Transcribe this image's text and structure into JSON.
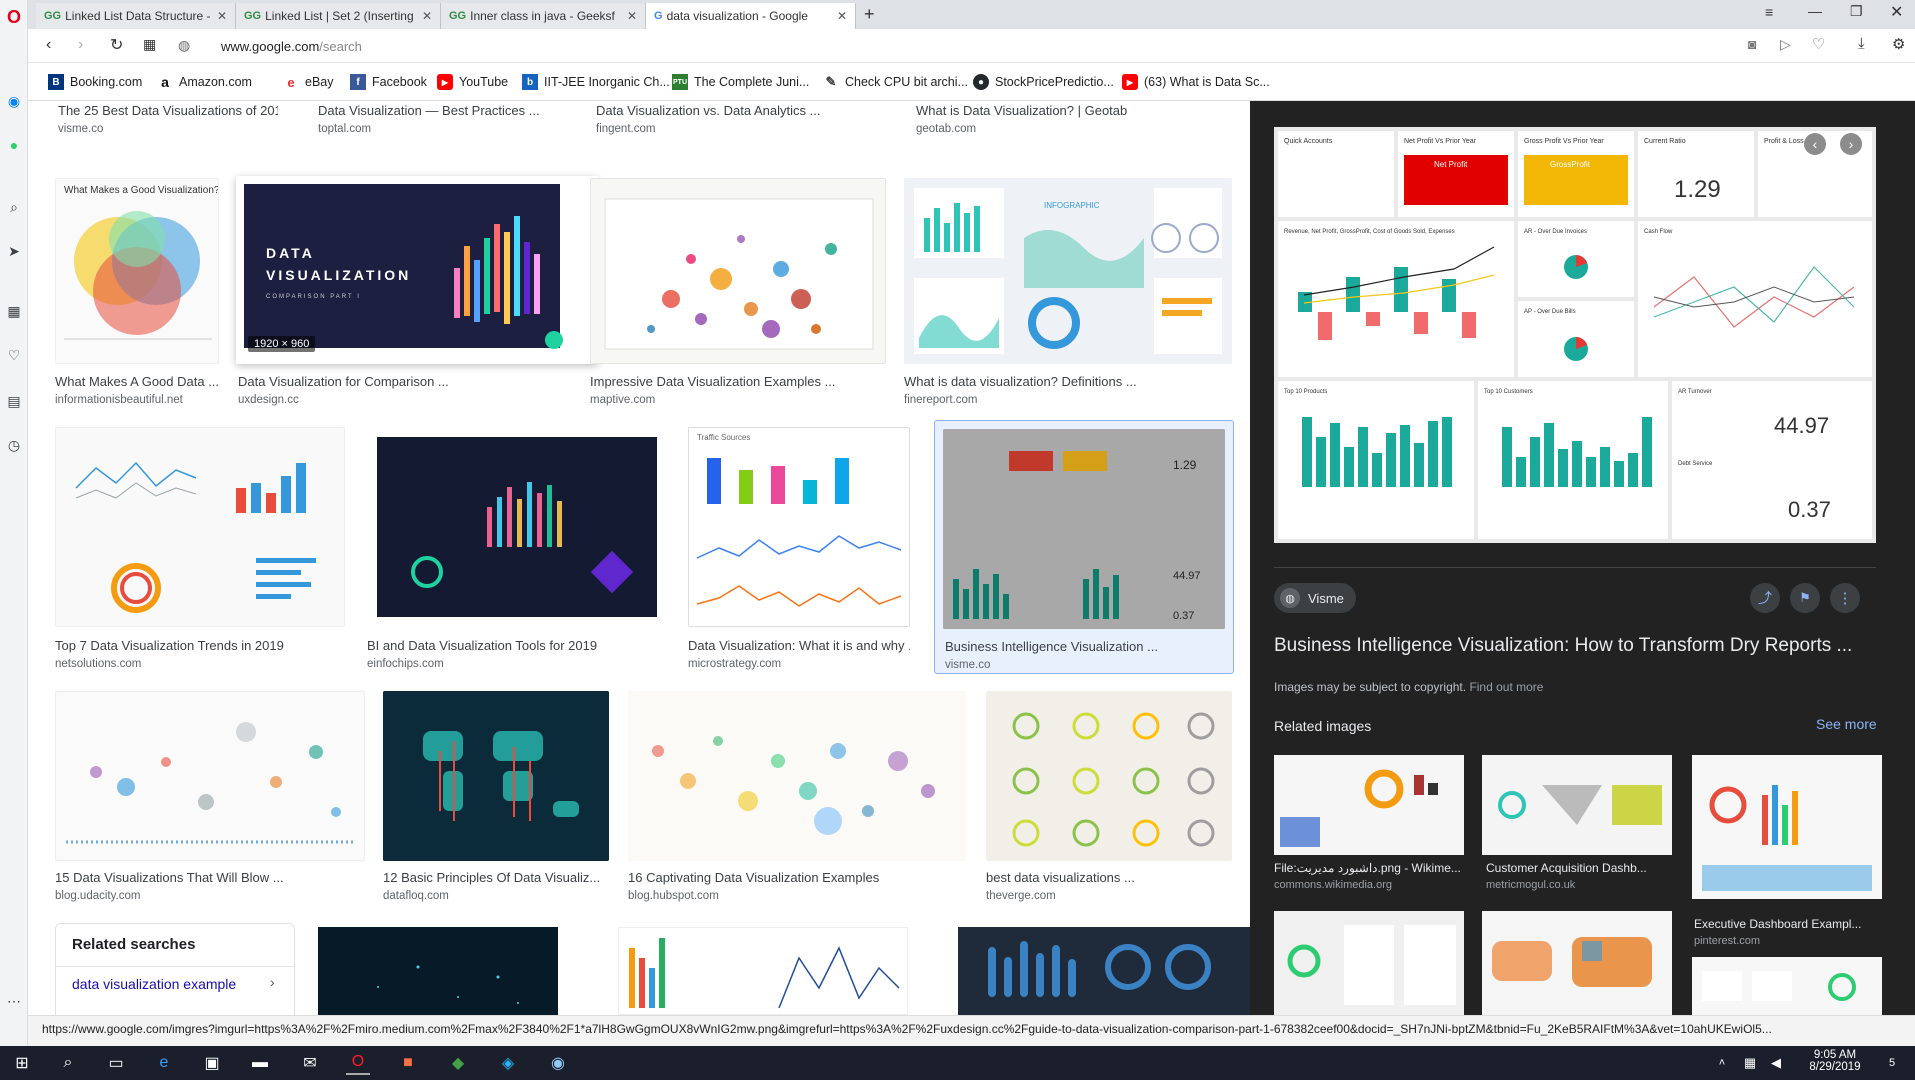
{
  "tabs": [
    {
      "label": "Linked List Data Structure -",
      "fav": "GG"
    },
    {
      "label": "Linked List | Set 2 (Inserting",
      "fav": "GG"
    },
    {
      "label": "Inner class in java - Geeksf",
      "fav": "GG"
    },
    {
      "label": "data visualization - Google",
      "fav": "G"
    }
  ],
  "address": {
    "host": "www.google.com",
    "path": "/search"
  },
  "bookmarks": [
    {
      "label": "Booking.com",
      "color": "#003580",
      "glyph": "B"
    },
    {
      "label": "Amazon.com",
      "color": "#111111",
      "glyph": "a"
    },
    {
      "label": "eBay",
      "color": "#e53238",
      "glyph": "e"
    },
    {
      "label": "Facebook",
      "color": "#3b5998",
      "glyph": "f"
    },
    {
      "label": "YouTube",
      "color": "#ff0000",
      "glyph": "▶"
    },
    {
      "label": "IIT-JEE Inorganic Ch...",
      "color": "#1565c0",
      "glyph": "b"
    },
    {
      "label": "The Complete Juni...",
      "color": "#2e7d32",
      "glyph": "PTU"
    },
    {
      "label": "Check CPU bit archi...",
      "color": "#444444",
      "glyph": "✎"
    },
    {
      "label": "StockPricePredictio...",
      "color": "#24292e",
      "glyph": "●"
    },
    {
      "label": "(63) What is Data Sc...",
      "color": "#ff0000",
      "glyph": "▶"
    }
  ],
  "top_row": [
    {
      "title": "The 25 Best Data Visualizations of 201 ...",
      "src": "visme.co"
    },
    {
      "title": "Data Visualization — Best Practices ...",
      "src": "toptal.com"
    },
    {
      "title": "Data Visualization vs. Data Analytics ...",
      "src": "fingent.com"
    },
    {
      "title": "What is Data Visualization? | Geotab",
      "src": "geotab.com"
    }
  ],
  "row1": [
    {
      "title": "What Makes A Good Data ...",
      "src": "informationisbeautiful.net"
    },
    {
      "title": "Data Visualization for Comparison ...",
      "src": "uxdesign.cc",
      "size": "1920 × 960",
      "banner1": "DATA",
      "banner2": "VISUALIZATION",
      "banner3": "COMPARISON PART I"
    },
    {
      "title": "Impressive Data Visualization Examples ...",
      "src": "maptive.com"
    },
    {
      "title": "What is data visualization? Definitions ...",
      "src": "finereport.com",
      "banner1": "INFOGRAPHIC"
    }
  ],
  "row2": [
    {
      "title": "Top 7 Data Visualization Trends in 2019",
      "src": "netsolutions.com"
    },
    {
      "title": "BI and Data Visualization Tools for 2019",
      "src": "einfochips.com"
    },
    {
      "title": "Data Visualization: What it is and why ...",
      "src": "microstrategy.com",
      "banner1": "Traffic Sources"
    },
    {
      "title": "Business Intelligence Visualization ...",
      "src": "visme.co"
    }
  ],
  "row3": [
    {
      "title": "15 Data Visualizations That Will Blow ...",
      "src": "blog.udacity.com"
    },
    {
      "title": "12 Basic Principles Of Data Visualiz...",
      "src": "datafloq.com"
    },
    {
      "title": "16 Captivating Data Visualization Examples",
      "src": "blog.hubspot.com"
    },
    {
      "title": "best data visualizations ...",
      "src": "theverge.com"
    }
  ],
  "related_searches": {
    "heading": "Related searches",
    "item": "data visualization example"
  },
  "panel": {
    "source": "Visme",
    "title": "Business Intelligence Visualization: How to Transform Dry Reports ...",
    "copyright": "Images may be subject to copyright.",
    "find_out_more": "Find out more",
    "related_heading": "Related images",
    "see_more": "See more",
    "dash": {
      "tiles": [
        "Quick Accounts",
        "Net Profit Vs Prior Year",
        "Gross Profit Vs Prior Year",
        "Current Ratio",
        "Profit & Loss"
      ],
      "current_ratio": "1.29",
      "net_profit": "Net Profit",
      "gross_profit": "GrossProfit",
      "ar_turnover": "AR Turnover",
      "ar_value": "44.97",
      "debt_service": "Debt Service",
      "debt_value": "0.37",
      "top_products": "Top 10 Products",
      "top_customers": "Top 10 Customers",
      "chart_title": "Revenue, Net Profit, GrossProfit, Cost of Goods Sold, Expenses",
      "ar_invoices": "AR - Over Due Invoices",
      "ap_bills": "AP - Over Due Bills",
      "cash_flow": "Cash Flow"
    },
    "related": [
      {
        "title": "File:داشبورد مدیریت.png - Wikime...",
        "src": "commons.wikimedia.org"
      },
      {
        "title": "Customer Acquisition Dashb...",
        "src": "metricmogul.co.uk"
      },
      {
        "title": "Executive Dashboard Exampl...",
        "src": "pinterest.com"
      }
    ]
  },
  "status_url": "https://www.google.com/imgres?imgurl=https%3A%2F%2Fmiro.medium.com%2Fmax%2F3840%2F1*a7lH8GwGgmOUX8vWnIG2mw.png&imgrefurl=https%3A%2F%2Fuxdesign.cc%2Fguide-to-data-visualization-comparison-part-1-678382ceef00&docid=_SH7nJNi-bptZM&tbnid=Fu_2KeB5RAIFtM%3A&vet=10ahUKEwiOl5...",
  "clock": {
    "time": "9:05 AM",
    "date": "8/29/2019"
  },
  "notifications": "5"
}
